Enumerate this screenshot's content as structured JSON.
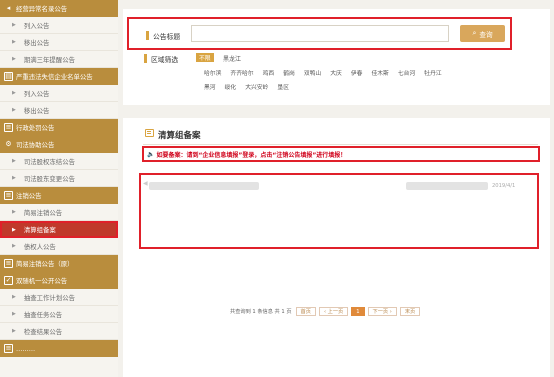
{
  "sidebar": {
    "items": [
      {
        "type": "group",
        "icon": "speaker-icon",
        "label": "经营异常名录公告"
      },
      {
        "type": "item",
        "label": "列入公告"
      },
      {
        "type": "item",
        "label": "移出公告"
      },
      {
        "type": "item",
        "label": "期满三年提醒公告"
      },
      {
        "type": "group",
        "icon": "book-icon",
        "label": "严重违法失信企业名单公告"
      },
      {
        "type": "item",
        "label": "列入公告"
      },
      {
        "type": "item",
        "label": "移出公告"
      },
      {
        "type": "group",
        "icon": "document-icon",
        "label": "行政处罚公告"
      },
      {
        "type": "group",
        "icon": "gear-icon",
        "label": "司法协助公告"
      },
      {
        "type": "item",
        "label": "司法股权冻结公告"
      },
      {
        "type": "item",
        "label": "司法股东变更公告"
      },
      {
        "type": "group",
        "icon": "document-icon",
        "label": "注销公告"
      },
      {
        "type": "item",
        "label": "简易注销公告"
      },
      {
        "type": "item",
        "label": "清算组备案",
        "active": true
      },
      {
        "type": "item",
        "label": "债权人公告"
      },
      {
        "type": "group",
        "icon": "document-icon",
        "label": "简易注销公告（原）"
      },
      {
        "type": "group",
        "icon": "checklist-icon",
        "label": "双随机一公开公告"
      },
      {
        "type": "item",
        "label": "抽查工作计划公告"
      },
      {
        "type": "item",
        "label": "抽查任务公告"
      },
      {
        "type": "item",
        "label": "检查结果公告"
      },
      {
        "type": "group",
        "icon": "document-icon",
        "label": "………"
      }
    ]
  },
  "search": {
    "title_label": "公告标题",
    "input_value": "",
    "button_label": "查询"
  },
  "region": {
    "label": "区域筛选",
    "tag": "不限",
    "province": "黑龙江",
    "cities_row1": [
      "哈尔滨",
      "齐齐哈尔",
      "鸡西",
      "鹤岗",
      "双鸭山",
      "大庆",
      "伊春",
      "佳木斯",
      "七台河",
      "牡丹江"
    ],
    "cities_row2": [
      "黑河",
      "绥化",
      "大兴安岭",
      "垦区"
    ]
  },
  "section": {
    "title": "清算组备案",
    "notice": "如要备案：请到“企业信息填报”登录，点击“注销公告填报”进行填报！"
  },
  "result": {
    "date": "2019/4/1"
  },
  "pagination": {
    "summary": "共查询到 1 条信息 共 1 页",
    "first": "首页",
    "prev": "‹ 上一页",
    "current": "1",
    "next": "下一页 ›",
    "last": "末页"
  },
  "colors": {
    "accent": "#b98d3d",
    "highlight": "#e0202a",
    "button": "#d9a75c"
  }
}
